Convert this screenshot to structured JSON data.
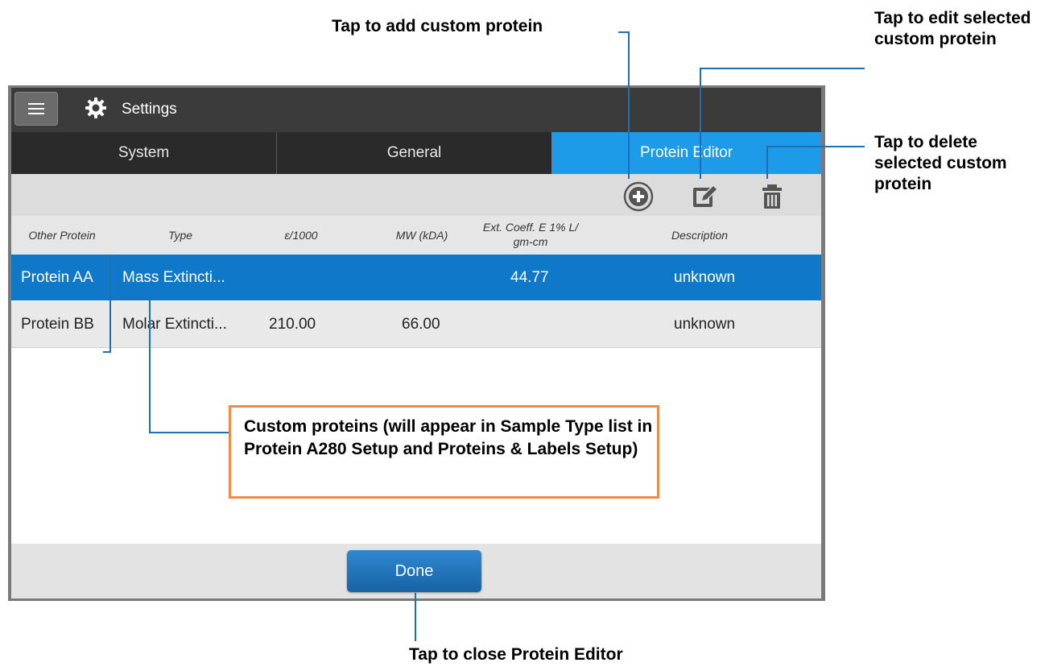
{
  "annotations": {
    "add": "Tap to add custom protein",
    "edit": "Tap to edit selected custom protein",
    "delete": "Tap to delete selected custom protein",
    "close": "Tap to close Protein Editor",
    "custom": "Custom proteins (will appear in Sample Type list in Protein A280 Setup and Proteins & Labels Setup)"
  },
  "app": {
    "title": "Settings"
  },
  "tabs": [
    "System",
    "General",
    "Protein Editor"
  ],
  "active_tab": "Protein Editor",
  "toolbar": {
    "icons": [
      "add-icon",
      "edit-icon",
      "delete-icon"
    ]
  },
  "table": {
    "columns": [
      "Other Protein",
      "Type",
      "ε/1000",
      "MW (kDA)",
      "Ext. Coeff. E 1% L/ gm-cm",
      "Description"
    ],
    "rows": [
      {
        "name": "Protein AA",
        "type": "Mass Extincti...",
        "eps": "",
        "mw": "",
        "ext": "44.77",
        "desc": "unknown",
        "selected": true
      },
      {
        "name": "Protein BB",
        "type": "Molar Extincti...",
        "eps": "210.00",
        "mw": "66.00",
        "ext": "",
        "desc": "unknown",
        "selected": false
      }
    ]
  },
  "footer": {
    "done_label": "Done"
  },
  "colors": {
    "accent": "#1e9be8",
    "selected_row": "#1078c8",
    "callout_border": "#f08a46",
    "leader_line": "#1f6fb2"
  }
}
